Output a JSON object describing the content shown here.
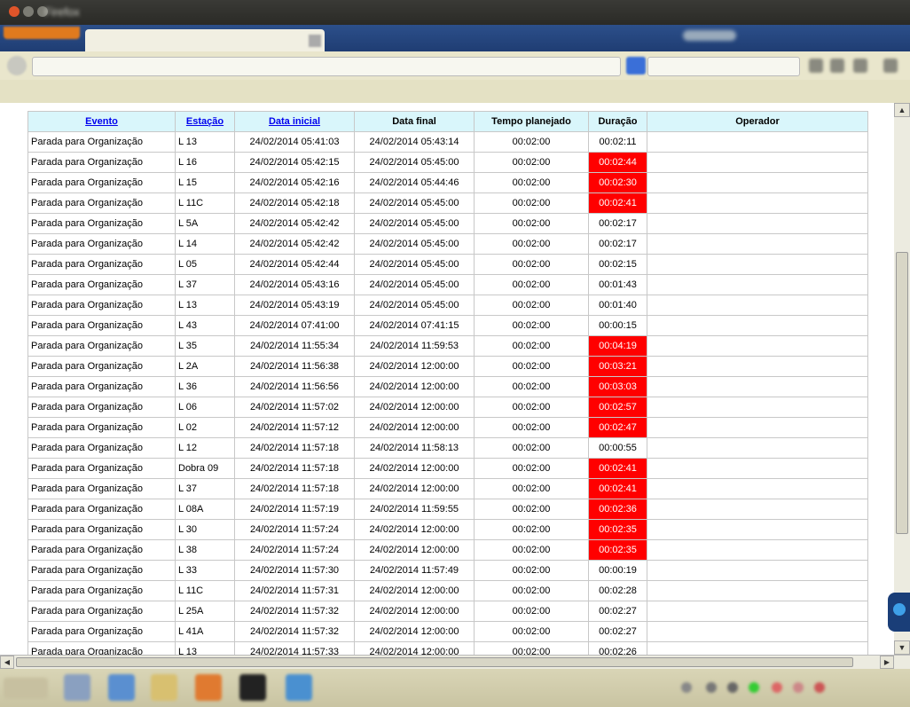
{
  "window": {
    "title": "Firefox",
    "tab_label": "",
    "url": "",
    "search_placeholder": ""
  },
  "bookmarks": [
    "",
    ""
  ],
  "table": {
    "columns": [
      {
        "label": "Evento",
        "sortable": true
      },
      {
        "label": "Estação",
        "sortable": true
      },
      {
        "label": "Data inicial",
        "sortable": true
      },
      {
        "label": "Data final",
        "sortable": false
      },
      {
        "label": "Tempo planejado",
        "sortable": false
      },
      {
        "label": "Duração",
        "sortable": false
      },
      {
        "label": "Operador",
        "sortable": false
      }
    ],
    "rows": [
      {
        "evento": "Parada para Organização",
        "estacao": "L 13",
        "inicio": "24/02/2014 05:41:03",
        "fim": "24/02/2014 05:43:14",
        "planejado": "00:02:00",
        "duracao": "00:02:11",
        "excedido": false,
        "operador": ""
      },
      {
        "evento": "Parada para Organização",
        "estacao": "L 16",
        "inicio": "24/02/2014 05:42:15",
        "fim": "24/02/2014 05:45:00",
        "planejado": "00:02:00",
        "duracao": "00:02:44",
        "excedido": true,
        "operador": ""
      },
      {
        "evento": "Parada para Organização",
        "estacao": "L 15",
        "inicio": "24/02/2014 05:42:16",
        "fim": "24/02/2014 05:44:46",
        "planejado": "00:02:00",
        "duracao": "00:02:30",
        "excedido": true,
        "operador": ""
      },
      {
        "evento": "Parada para Organização",
        "estacao": "L 11C",
        "inicio": "24/02/2014 05:42:18",
        "fim": "24/02/2014 05:45:00",
        "planejado": "00:02:00",
        "duracao": "00:02:41",
        "excedido": true,
        "operador": ""
      },
      {
        "evento": "Parada para Organização",
        "estacao": "L 5A",
        "inicio": "24/02/2014 05:42:42",
        "fim": "24/02/2014 05:45:00",
        "planejado": "00:02:00",
        "duracao": "00:02:17",
        "excedido": false,
        "operador": ""
      },
      {
        "evento": "Parada para Organização",
        "estacao": "L 14",
        "inicio": "24/02/2014 05:42:42",
        "fim": "24/02/2014 05:45:00",
        "planejado": "00:02:00",
        "duracao": "00:02:17",
        "excedido": false,
        "operador": ""
      },
      {
        "evento": "Parada para Organização",
        "estacao": "L 05",
        "inicio": "24/02/2014 05:42:44",
        "fim": "24/02/2014 05:45:00",
        "planejado": "00:02:00",
        "duracao": "00:02:15",
        "excedido": false,
        "operador": ""
      },
      {
        "evento": "Parada para Organização",
        "estacao": "L 37",
        "inicio": "24/02/2014 05:43:16",
        "fim": "24/02/2014 05:45:00",
        "planejado": "00:02:00",
        "duracao": "00:01:43",
        "excedido": false,
        "operador": ""
      },
      {
        "evento": "Parada para Organização",
        "estacao": "L 13",
        "inicio": "24/02/2014 05:43:19",
        "fim": "24/02/2014 05:45:00",
        "planejado": "00:02:00",
        "duracao": "00:01:40",
        "excedido": false,
        "operador": ""
      },
      {
        "evento": "Parada para Organização",
        "estacao": "L 43",
        "inicio": "24/02/2014 07:41:00",
        "fim": "24/02/2014 07:41:15",
        "planejado": "00:02:00",
        "duracao": "00:00:15",
        "excedido": false,
        "operador": ""
      },
      {
        "evento": "Parada para Organização",
        "estacao": "L 35",
        "inicio": "24/02/2014 11:55:34",
        "fim": "24/02/2014 11:59:53",
        "planejado": "00:02:00",
        "duracao": "00:04:19",
        "excedido": true,
        "operador": ""
      },
      {
        "evento": "Parada para Organização",
        "estacao": "L 2A",
        "inicio": "24/02/2014 11:56:38",
        "fim": "24/02/2014 12:00:00",
        "planejado": "00:02:00",
        "duracao": "00:03:21",
        "excedido": true,
        "operador": ""
      },
      {
        "evento": "Parada para Organização",
        "estacao": "L 36",
        "inicio": "24/02/2014 11:56:56",
        "fim": "24/02/2014 12:00:00",
        "planejado": "00:02:00",
        "duracao": "00:03:03",
        "excedido": true,
        "operador": ""
      },
      {
        "evento": "Parada para Organização",
        "estacao": "L 06",
        "inicio": "24/02/2014 11:57:02",
        "fim": "24/02/2014 12:00:00",
        "planejado": "00:02:00",
        "duracao": "00:02:57",
        "excedido": true,
        "operador": ""
      },
      {
        "evento": "Parada para Organização",
        "estacao": "L 02",
        "inicio": "24/02/2014 11:57:12",
        "fim": "24/02/2014 12:00:00",
        "planejado": "00:02:00",
        "duracao": "00:02:47",
        "excedido": true,
        "operador": ""
      },
      {
        "evento": "Parada para Organização",
        "estacao": "L 12",
        "inicio": "24/02/2014 11:57:18",
        "fim": "24/02/2014 11:58:13",
        "planejado": "00:02:00",
        "duracao": "00:00:55",
        "excedido": false,
        "operador": ""
      },
      {
        "evento": "Parada para Organização",
        "estacao": "Dobra 09",
        "inicio": "24/02/2014 11:57:18",
        "fim": "24/02/2014 12:00:00",
        "planejado": "00:02:00",
        "duracao": "00:02:41",
        "excedido": true,
        "operador": ""
      },
      {
        "evento": "Parada para Organização",
        "estacao": "L 37",
        "inicio": "24/02/2014 11:57:18",
        "fim": "24/02/2014 12:00:00",
        "planejado": "00:02:00",
        "duracao": "00:02:41",
        "excedido": true,
        "operador": ""
      },
      {
        "evento": "Parada para Organização",
        "estacao": "L 08A",
        "inicio": "24/02/2014 11:57:19",
        "fim": "24/02/2014 11:59:55",
        "planejado": "00:02:00",
        "duracao": "00:02:36",
        "excedido": true,
        "operador": ""
      },
      {
        "evento": "Parada para Organização",
        "estacao": "L 30",
        "inicio": "24/02/2014 11:57:24",
        "fim": "24/02/2014 12:00:00",
        "planejado": "00:02:00",
        "duracao": "00:02:35",
        "excedido": true,
        "operador": ""
      },
      {
        "evento": "Parada para Organização",
        "estacao": "L 38",
        "inicio": "24/02/2014 11:57:24",
        "fim": "24/02/2014 12:00:00",
        "planejado": "00:02:00",
        "duracao": "00:02:35",
        "excedido": true,
        "operador": ""
      },
      {
        "evento": "Parada para Organização",
        "estacao": "L 33",
        "inicio": "24/02/2014 11:57:30",
        "fim": "24/02/2014 11:57:49",
        "planejado": "00:02:00",
        "duracao": "00:00:19",
        "excedido": false,
        "operador": ""
      },
      {
        "evento": "Parada para Organização",
        "estacao": "L 11C",
        "inicio": "24/02/2014 11:57:31",
        "fim": "24/02/2014 12:00:00",
        "planejado": "00:02:00",
        "duracao": "00:02:28",
        "excedido": false,
        "operador": ""
      },
      {
        "evento": "Parada para Organização",
        "estacao": "L 25A",
        "inicio": "24/02/2014 11:57:32",
        "fim": "24/02/2014 12:00:00",
        "planejado": "00:02:00",
        "duracao": "00:02:27",
        "excedido": false,
        "operador": ""
      },
      {
        "evento": "Parada para Organização",
        "estacao": "L 41A",
        "inicio": "24/02/2014 11:57:32",
        "fim": "24/02/2014 12:00:00",
        "planejado": "00:02:00",
        "duracao": "00:02:27",
        "excedido": false,
        "operador": ""
      },
      {
        "evento": "Parada para Organização",
        "estacao": "L 13",
        "inicio": "24/02/2014 11:57:33",
        "fim": "24/02/2014 12:00:00",
        "planejado": "00:02:00",
        "duracao": "00:02:26",
        "excedido": false,
        "operador": ""
      }
    ]
  },
  "colors": {
    "header_bg": "#d9f6fb",
    "exceeded_bg": "#ff0000",
    "exceeded_fg": "#ffffff",
    "link": "#0000ee"
  },
  "icons": {
    "close": "close-icon",
    "back": "back-icon",
    "search": "search-icon",
    "teamviewer": "teamviewer-icon"
  }
}
